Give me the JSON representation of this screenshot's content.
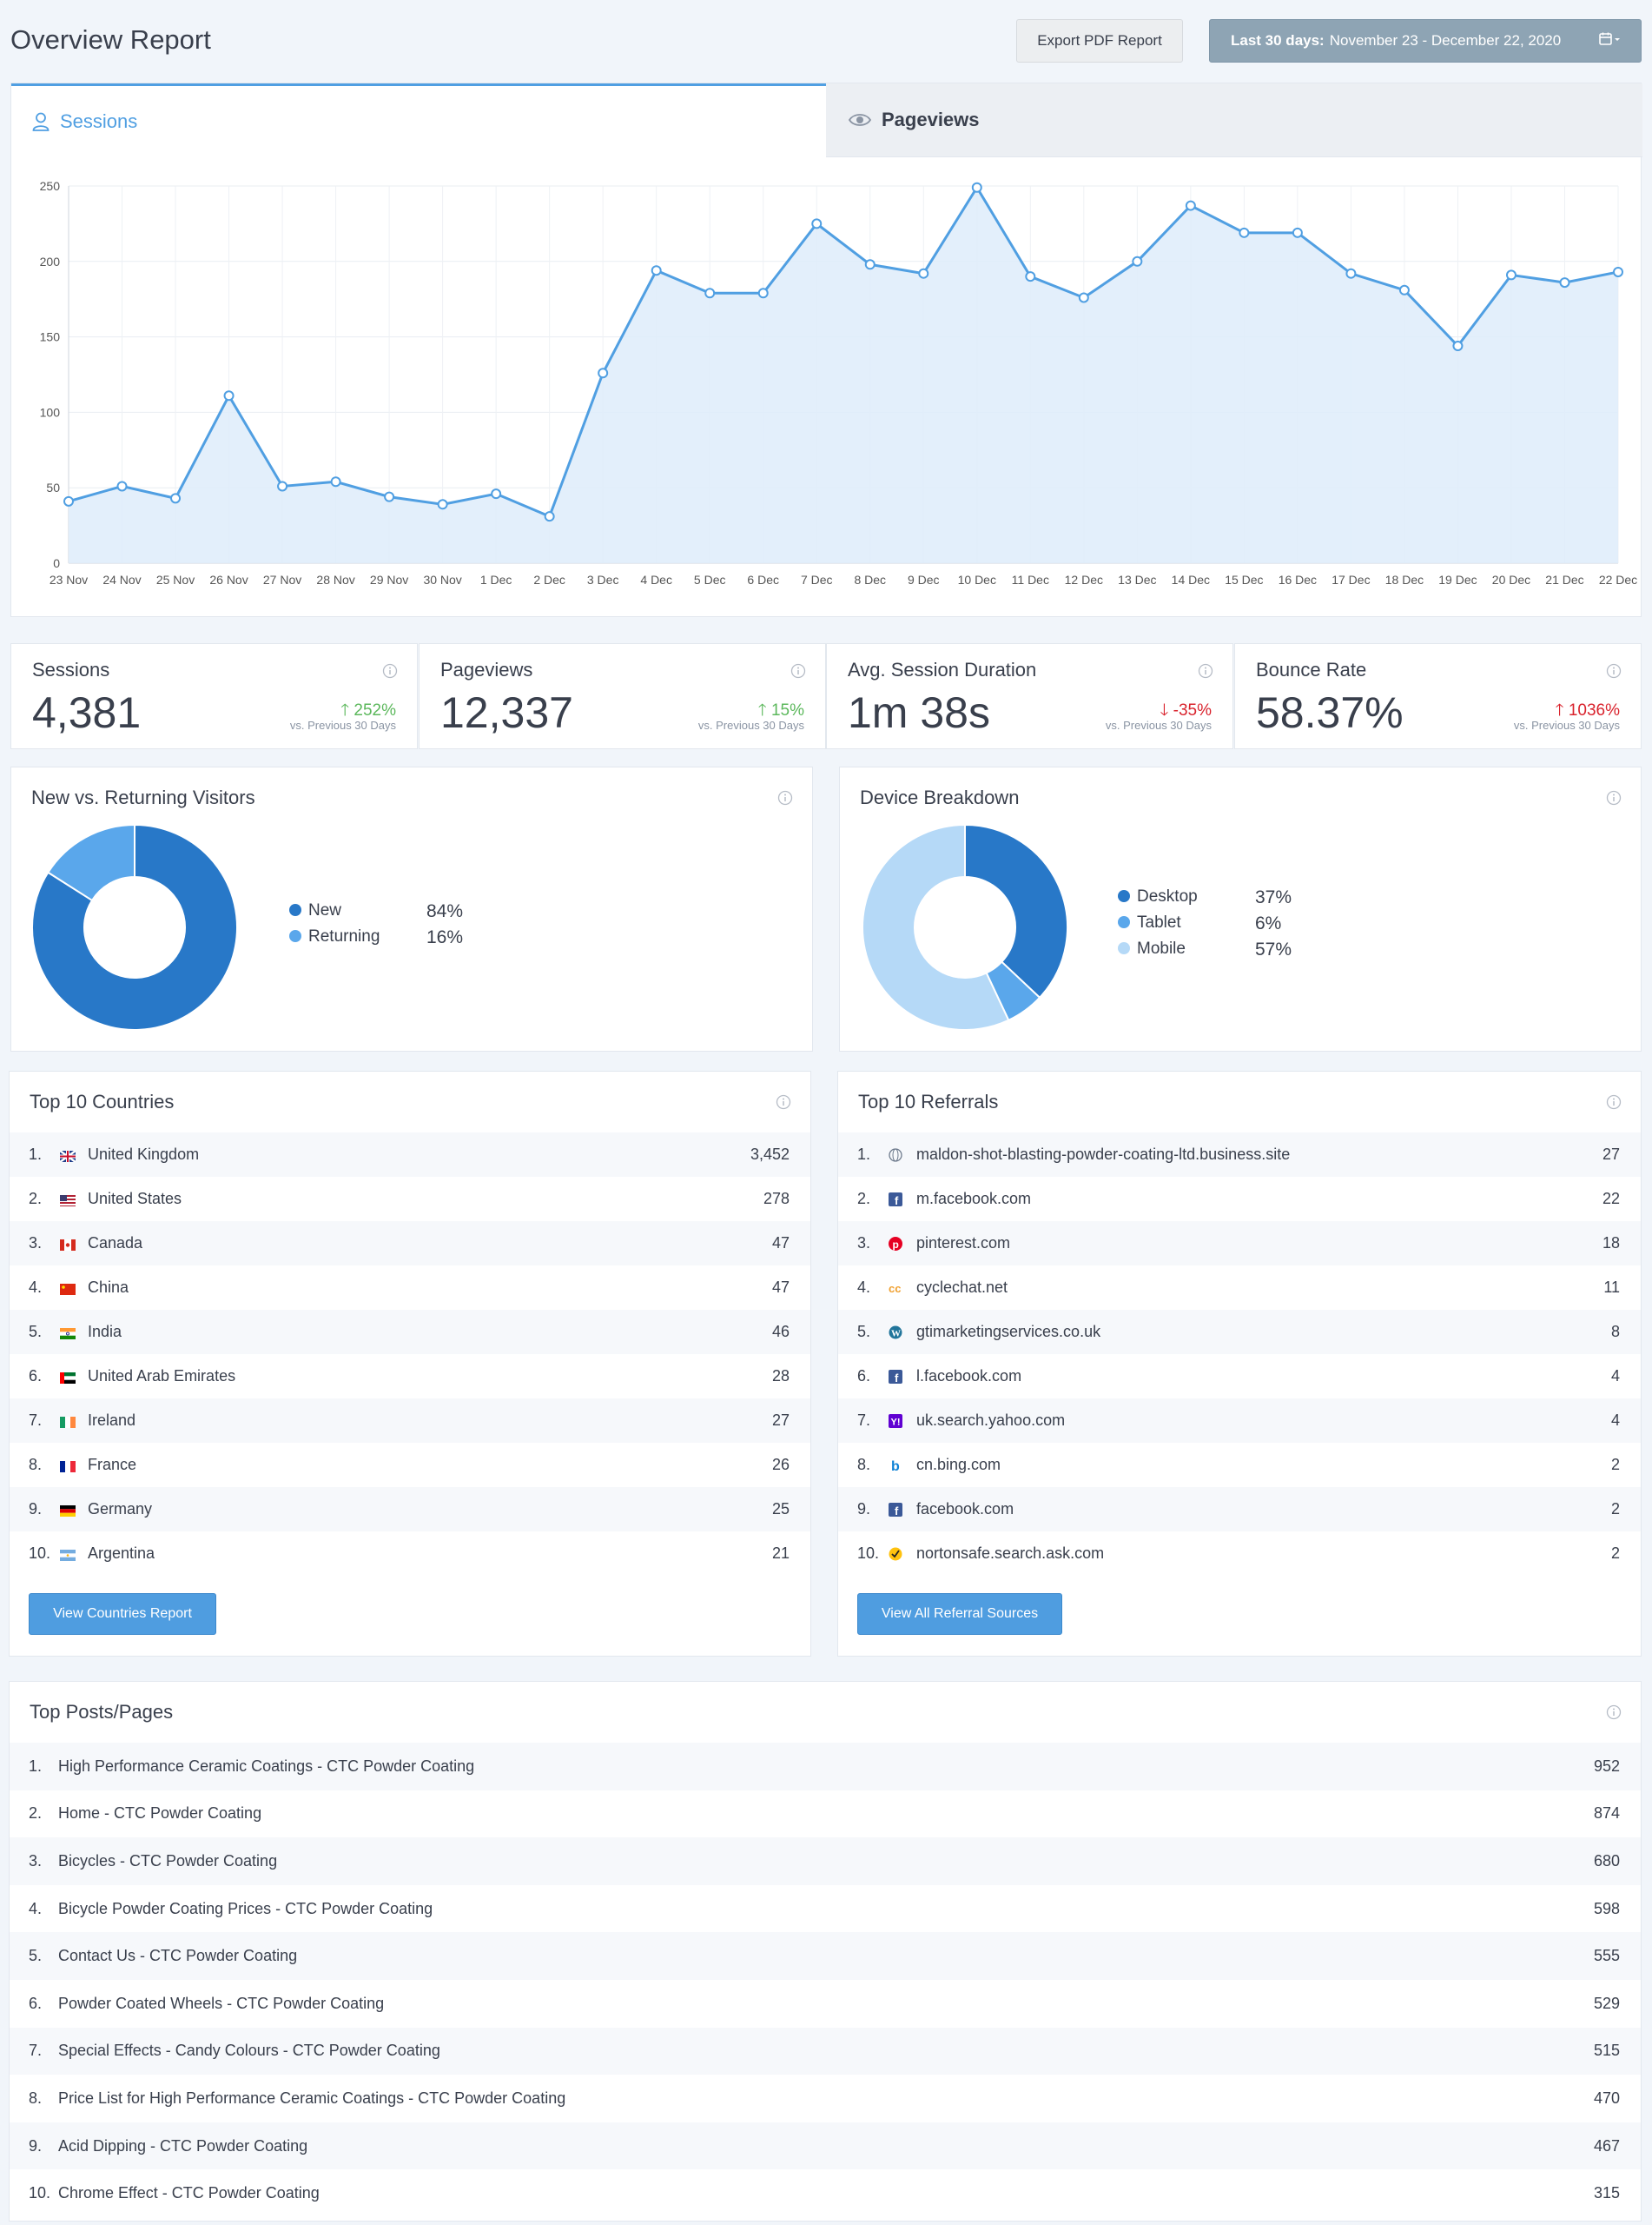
{
  "header": {
    "title": "Overview Report",
    "export_label": "Export PDF Report",
    "date_prefix": "Last 30 days:",
    "date_range": "November 23 - December 22, 2020"
  },
  "tabs": {
    "sessions": "Sessions",
    "pageviews": "Pageviews"
  },
  "chart_data": {
    "type": "area",
    "categories": [
      "23 Nov",
      "24 Nov",
      "25 Nov",
      "26 Nov",
      "27 Nov",
      "28 Nov",
      "29 Nov",
      "30 Nov",
      "1 Dec",
      "2 Dec",
      "3 Dec",
      "4 Dec",
      "5 Dec",
      "6 Dec",
      "7 Dec",
      "8 Dec",
      "9 Dec",
      "10 Dec",
      "11 Dec",
      "12 Dec",
      "13 Dec",
      "14 Dec",
      "15 Dec",
      "16 Dec",
      "17 Dec",
      "18 Dec",
      "19 Dec",
      "20 Dec",
      "21 Dec",
      "22 Dec"
    ],
    "values": [
      41,
      51,
      43,
      111,
      51,
      54,
      44,
      39,
      46,
      31,
      126,
      194,
      179,
      179,
      225,
      198,
      192,
      249,
      190,
      176,
      200,
      237,
      219,
      219,
      192,
      181,
      144,
      191,
      186,
      193
    ],
    "ylim": [
      0,
      250
    ],
    "yticks": [
      0,
      50,
      100,
      150,
      200,
      250
    ],
    "grid": true,
    "colors": {
      "line": "#509fe2",
      "fill": "#deecfa"
    }
  },
  "metrics": [
    {
      "label": "Sessions",
      "value": "4,381",
      "change": "252%",
      "direction": "up",
      "vs": "vs. Previous 30 Days"
    },
    {
      "label": "Pageviews",
      "value": "12,337",
      "change": "15%",
      "direction": "up",
      "vs": "vs. Previous 30 Days"
    },
    {
      "label": "Avg. Session Duration",
      "value": "1m 38s",
      "change": "-35%",
      "direction": "down",
      "vs": "vs. Previous 30 Days"
    },
    {
      "label": "Bounce Rate",
      "value": "58.37%",
      "change": "1036%",
      "direction": "down",
      "vs": "vs. Previous 30 Days"
    }
  ],
  "visitors": {
    "title": "New vs. Returning Visitors",
    "items": [
      {
        "label": "New",
        "value": "84%",
        "fraction": 0.84,
        "color": "#2878c8"
      },
      {
        "label": "Returning",
        "value": "16%",
        "fraction": 0.16,
        "color": "#5aa7eb"
      }
    ]
  },
  "devices": {
    "title": "Device Breakdown",
    "items": [
      {
        "label": "Desktop",
        "value": "37%",
        "fraction": 0.37,
        "color": "#2878c8"
      },
      {
        "label": "Tablet",
        "value": "6%",
        "fraction": 0.06,
        "color": "#5aa7eb"
      },
      {
        "label": "Mobile",
        "value": "57%",
        "fraction": 0.57,
        "color": "#b5d9f7"
      }
    ]
  },
  "countries": {
    "title": "Top 10 Countries",
    "button": "View Countries Report",
    "rows": [
      {
        "num": "1.",
        "name": "United Kingdom",
        "value": "3,452",
        "flag": "uk-flag-icon"
      },
      {
        "num": "2.",
        "name": "United States",
        "value": "278",
        "flag": "us-flag-icon"
      },
      {
        "num": "3.",
        "name": "Canada",
        "value": "47",
        "flag": "ca-flag-icon"
      },
      {
        "num": "4.",
        "name": "China",
        "value": "47",
        "flag": "cn-flag-icon"
      },
      {
        "num": "5.",
        "name": "India",
        "value": "46",
        "flag": "in-flag-icon"
      },
      {
        "num": "6.",
        "name": "United Arab Emirates",
        "value": "28",
        "flag": "ae-flag-icon"
      },
      {
        "num": "7.",
        "name": "Ireland",
        "value": "27",
        "flag": "ie-flag-icon"
      },
      {
        "num": "8.",
        "name": "France",
        "value": "26",
        "flag": "fr-flag-icon"
      },
      {
        "num": "9.",
        "name": "Germany",
        "value": "25",
        "flag": "de-flag-icon"
      },
      {
        "num": "10.",
        "name": "Argentina",
        "value": "21",
        "flag": "ar-flag-icon"
      }
    ]
  },
  "referrals": {
    "title": "Top 10 Referrals",
    "button": "View All Referral Sources",
    "rows": [
      {
        "num": "1.",
        "name": "maldon-shot-blasting-powder-coating-ltd.business.site",
        "value": "27",
        "icon": "globe-icon"
      },
      {
        "num": "2.",
        "name": "m.facebook.com",
        "value": "22",
        "icon": "facebook-icon"
      },
      {
        "num": "3.",
        "name": "pinterest.com",
        "value": "18",
        "icon": "pinterest-icon"
      },
      {
        "num": "4.",
        "name": "cyclechat.net",
        "value": "11",
        "icon": "cyclechat-icon"
      },
      {
        "num": "5.",
        "name": "gtimarketingservices.co.uk",
        "value": "8",
        "icon": "wordpress-icon"
      },
      {
        "num": "6.",
        "name": "l.facebook.com",
        "value": "4",
        "icon": "facebook-icon"
      },
      {
        "num": "7.",
        "name": "uk.search.yahoo.com",
        "value": "4",
        "icon": "yahoo-icon"
      },
      {
        "num": "8.",
        "name": "cn.bing.com",
        "value": "2",
        "icon": "bing-icon"
      },
      {
        "num": "9.",
        "name": "facebook.com",
        "value": "2",
        "icon": "facebook-icon"
      },
      {
        "num": "10.",
        "name": "nortonsafe.search.ask.com",
        "value": "2",
        "icon": "norton-icon"
      }
    ]
  },
  "posts": {
    "title": "Top Posts/Pages",
    "rows": [
      {
        "num": "1.",
        "name": "High Performance Ceramic Coatings - CTC Powder Coating",
        "value": "952"
      },
      {
        "num": "2.",
        "name": "Home - CTC Powder Coating",
        "value": "874"
      },
      {
        "num": "3.",
        "name": "Bicycles - CTC Powder Coating",
        "value": "680"
      },
      {
        "num": "4.",
        "name": "Bicycle Powder Coating Prices - CTC Powder Coating",
        "value": "598"
      },
      {
        "num": "5.",
        "name": "Contact Us - CTC Powder Coating",
        "value": "555"
      },
      {
        "num": "6.",
        "name": "Powder Coated Wheels - CTC Powder Coating",
        "value": "529"
      },
      {
        "num": "7.",
        "name": "Special Effects - Candy Colours - CTC Powder Coating",
        "value": "515"
      },
      {
        "num": "8.",
        "name": "Price List for High Performance Ceramic Coatings - CTC Powder Coating",
        "value": "470"
      },
      {
        "num": "9.",
        "name": "Acid Dipping - CTC Powder Coating",
        "value": "467"
      },
      {
        "num": "10.",
        "name": "Chrome Effect - CTC Powder Coating",
        "value": "315"
      }
    ]
  }
}
